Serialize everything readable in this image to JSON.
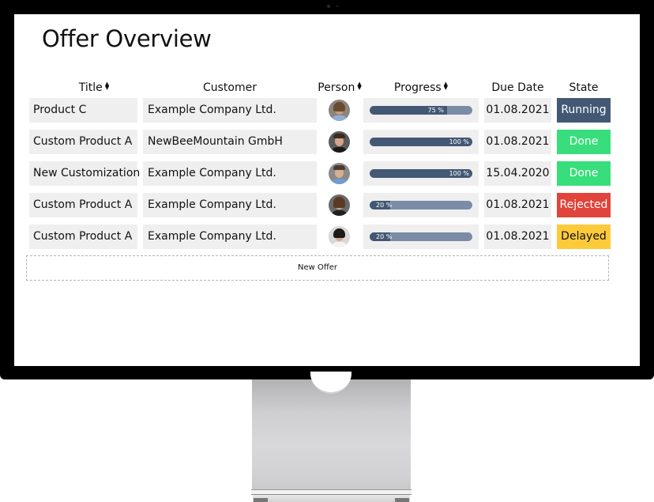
{
  "page": {
    "title": "Offer Overview"
  },
  "table": {
    "columns": [
      {
        "key": "title",
        "label": "Title",
        "sortable": true
      },
      {
        "key": "customer",
        "label": "Customer",
        "sortable": false
      },
      {
        "key": "person",
        "label": "Person",
        "sortable": true
      },
      {
        "key": "progress",
        "label": "Progress",
        "sortable": true
      },
      {
        "key": "due_date",
        "label": "Due Date",
        "sortable": false
      },
      {
        "key": "state",
        "label": "State",
        "sortable": false
      }
    ],
    "sort_icon": "sort-arrows-icon",
    "rows": [
      {
        "title": "Product C",
        "customer": "Example Company Ltd.",
        "person_icon": "avatar-curly-hair",
        "progress": 75,
        "progress_label": "75 %",
        "due_date": "01.08.2021",
        "state": "Running"
      },
      {
        "title": "Custom Product A",
        "customer": "NewBeeMountain GmbH",
        "person_icon": "avatar-short-hair-dark",
        "progress": 100,
        "progress_label": "100 %",
        "due_date": "01.08.2021",
        "state": "Done"
      },
      {
        "title": "New Customization",
        "customer": "Example Company Ltd.",
        "person_icon": "avatar-short-hair-light",
        "progress": 100,
        "progress_label": "100 %",
        "due_date": "15.04.2020",
        "state": "Done"
      },
      {
        "title": "Custom Product A",
        "customer": "Example Company Ltd.",
        "person_icon": "avatar-long-hair",
        "progress": 20,
        "progress_label": "20 %",
        "due_date": "01.08.2021",
        "state": "Rejected"
      },
      {
        "title": "Custom Product A",
        "customer": "Example Company Ltd.",
        "person_icon": "avatar-woman-dark-hair",
        "progress": 20,
        "progress_label": "20 %",
        "due_date": "01.08.2021",
        "state": "Delayed"
      }
    ]
  },
  "state_colors": {
    "Running": {
      "bg": "#435874",
      "fg": "#ffffff"
    },
    "Done": {
      "bg": "#38de7b",
      "fg": "#ffffff"
    },
    "Rejected": {
      "bg": "#e0443b",
      "fg": "#ffffff"
    },
    "Delayed": {
      "bg": "#ffca3a",
      "fg": "#111111"
    }
  },
  "progress_colors": {
    "fill": "#435874",
    "track": "#7a8ca6"
  },
  "new_offer_button": {
    "label": "New Offer"
  }
}
